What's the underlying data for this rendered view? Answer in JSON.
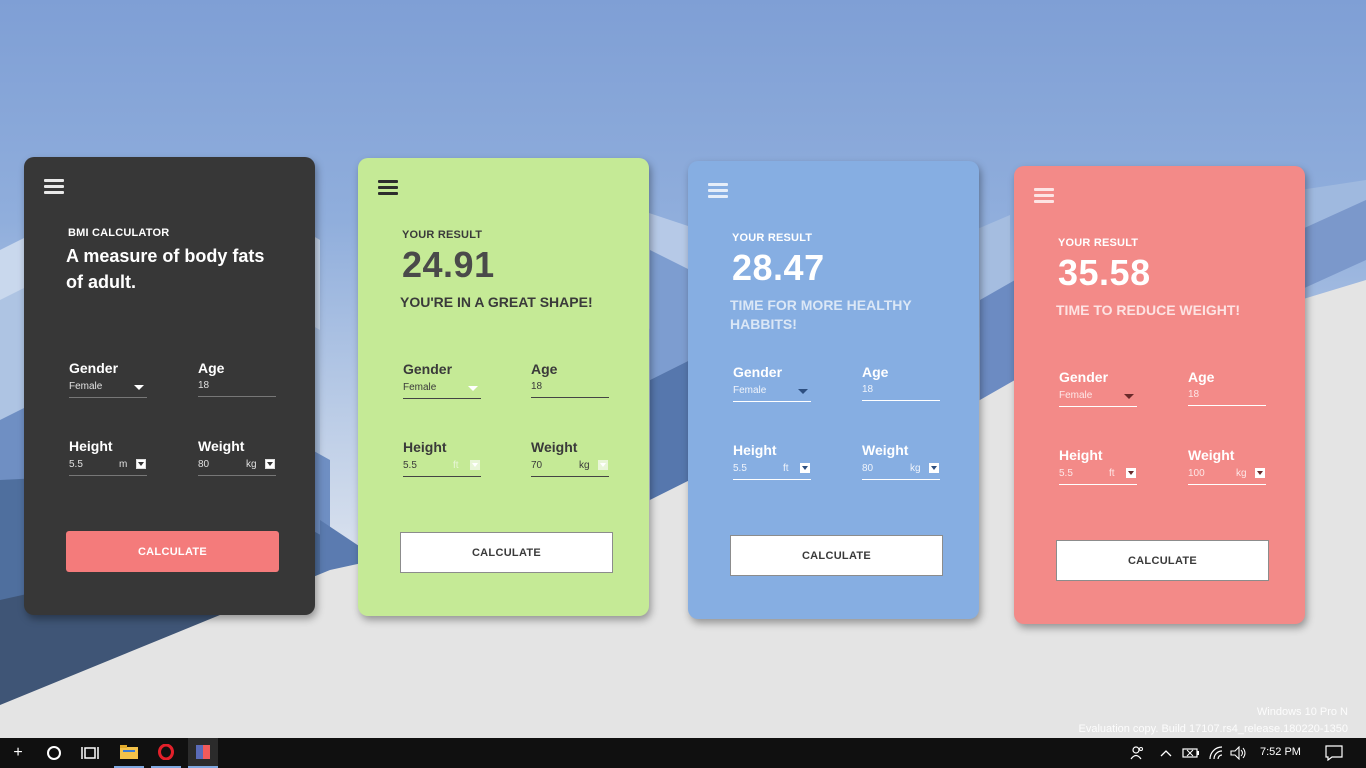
{
  "cards": [
    {
      "small_heading": "BMI CALCULATOR",
      "main_heading": "A measure of body fats of adult.",
      "gender_label": "Gender",
      "gender_value": "Female",
      "age_label": "Age",
      "age_value": "18",
      "height_label": "Height",
      "height_value": "5.5",
      "height_unit": "m",
      "weight_label": "Weight",
      "weight_value": "80",
      "weight_unit": "kg",
      "button_label": "CALCULATE"
    },
    {
      "small_heading": "YOUR RESULT",
      "result_value": "24.91",
      "message": "YOU'RE IN A GREAT SHAPE!",
      "gender_label": "Gender",
      "gender_value": "Female",
      "age_label": "Age",
      "age_value": "18",
      "height_label": "Height",
      "height_value": "5.5",
      "height_unit": "ft",
      "weight_label": "Weight",
      "weight_value": "70",
      "weight_unit": "kg",
      "button_label": "CALCULATE"
    },
    {
      "small_heading": "YOUR RESULT",
      "result_value": "28.47",
      "message": "TIME FOR MORE HEALTHY HABBITS!",
      "gender_label": "Gender",
      "gender_value": "Female",
      "age_label": "Age",
      "age_value": "18",
      "height_label": "Height",
      "height_value": "5.5",
      "height_unit": "ft",
      "weight_label": "Weight",
      "weight_value": "80",
      "weight_unit": "kg",
      "button_label": "CALCULATE"
    },
    {
      "small_heading": "YOUR RESULT",
      "result_value": "35.58",
      "message": "TIME TO REDUCE WEIGHT!",
      "gender_label": "Gender",
      "gender_value": "Female",
      "age_label": "Age",
      "age_value": "18",
      "height_label": "Height",
      "height_value": "5.5",
      "height_unit": "ft",
      "weight_label": "Weight",
      "weight_value": "100",
      "weight_unit": "kg",
      "button_label": "CALCULATE"
    }
  ],
  "watermark": {
    "line1": "Windows 10 Pro N",
    "line2": "Evaluation copy. Build 17107.rs4_release.180220-1350"
  },
  "taskbar": {
    "time": "7:52 PM",
    "icons": [
      "plus-icon",
      "cortana-icon",
      "task-view-icon",
      "file-explorer-icon",
      "opera-icon",
      "app-icon",
      "people-icon",
      "chevron-up-icon",
      "battery-icon",
      "wifi-icon",
      "volume-icon",
      "action-center-icon"
    ]
  },
  "colors": {
    "card1_bg": "#373737",
    "card2_bg": "#c5ea96",
    "card3_bg": "#86aee2",
    "card4_bg": "#f38a88",
    "accent_button": "#f47b7b"
  }
}
